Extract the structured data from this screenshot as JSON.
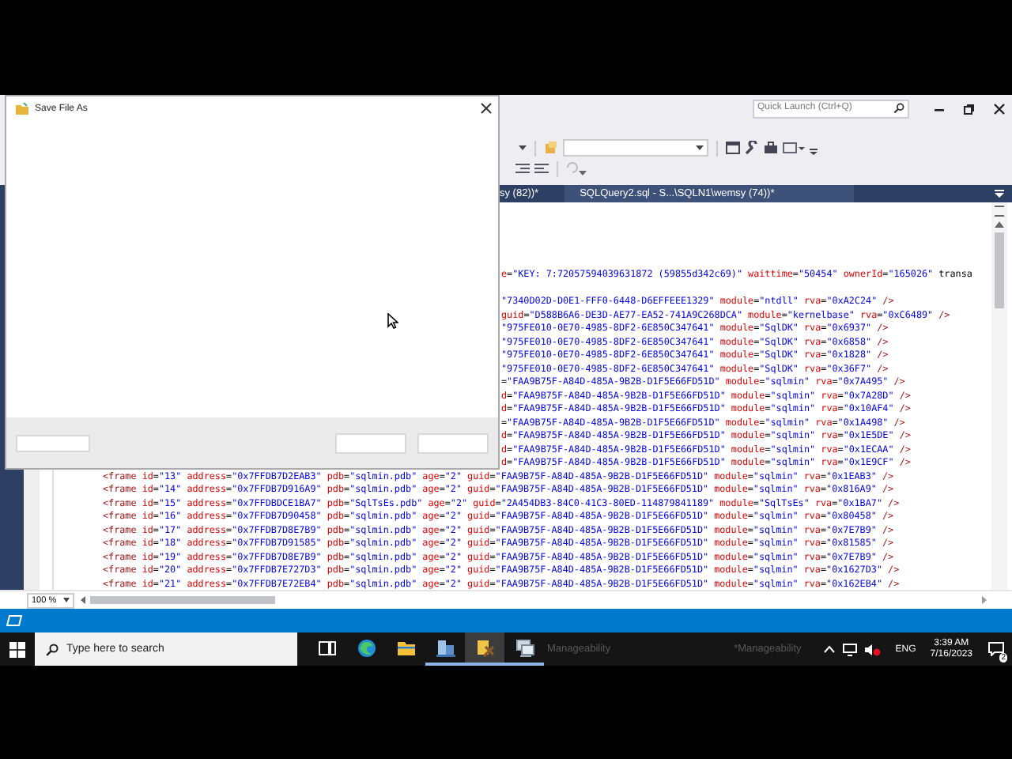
{
  "ssms": {
    "quick_launch": {
      "placeholder": "Quick Launch (Ctrl+Q)"
    },
    "tabs": [
      {
        "label": "sy (82))*",
        "selected": false
      },
      {
        "label": "SQLQuery2.sql - S...\\SQLN1\\wemsy (74))*",
        "selected": false
      }
    ],
    "header_line": "e=\"KEY: 7:72057594039631872 (59855d342c69)\" waittime=\"50454\" ownerId=\"165026\" transa",
    "upper_lines": [
      "\"7340D02D-D0E1-FFF0-6448-D6EFFEEE1329\" module=\"ntdll\" rva=\"0xA2C24\" />",
      "guid=\"D588B6A6-DE3D-AE77-EA52-741A9C268DCA\" module=\"kernelbase\" rva=\"0xC6489\" />",
      "\"975FE010-0E70-4985-8DF2-6E850C347641\" module=\"SqlDK\" rva=\"0x6937\" />",
      "\"975FE010-0E70-4985-8DF2-6E850C347641\" module=\"SqlDK\" rva=\"0x6858\" />",
      "\"975FE010-0E70-4985-8DF2-6E850C347641\" module=\"SqlDK\" rva=\"0x1828\" />",
      "\"975FE010-0E70-4985-8DF2-6E850C347641\" module=\"SqlDK\" rva=\"0x36F7\" />",
      "=\"FAA9B75F-A84D-485A-9B2B-D1F5E66FD51D\" module=\"sqlmin\" rva=\"0x7A495\" />",
      "d=\"FAA9B75F-A84D-485A-9B2B-D1F5E66FD51D\" module=\"sqlmin\" rva=\"0x7A28D\" />",
      "d=\"FAA9B75F-A84D-485A-9B2B-D1F5E66FD51D\" module=\"sqlmin\" rva=\"0x10AF4\" />",
      "=\"FAA9B75F-A84D-485A-9B2B-D1F5E66FD51D\" module=\"sqlmin\" rva=\"0x1A498\" />",
      "d=\"FAA9B75F-A84D-485A-9B2B-D1F5E66FD51D\" module=\"sqlmin\" rva=\"0x1E5DE\" />",
      "d=\"FAA9B75F-A84D-485A-9B2B-D1F5E66FD51D\" module=\"sqlmin\" rva=\"0x1ECAA\" />",
      "d=\"FAA9B75F-A84D-485A-9B2B-D1F5E66FD51D\" module=\"sqlmin\" rva=\"0x1E9CF\" />"
    ],
    "lines": [
      "<frame id=\"13\" address=\"0x7FFDB7D2EAB3\" pdb=\"sqlmin.pdb\" age=\"2\" guid=\"FAA9B75F-A84D-485A-9B2B-D1F5E66FD51D\" module=\"sqlmin\" rva=\"0x1EAB3\" />",
      "<frame id=\"14\" address=\"0x7FFDB7D916A9\" pdb=\"sqlmin.pdb\" age=\"2\" guid=\"FAA9B75F-A84D-485A-9B2B-D1F5E66FD51D\" module=\"sqlmin\" rva=\"0x816A9\" />",
      "<frame id=\"15\" address=\"0x7FFDBDCE1BA7\" pdb=\"SqlTsEs.pdb\" age=\"2\" guid=\"2A454DB3-84C0-41C3-80ED-114879841189\" module=\"SqlTsEs\" rva=\"0x1BA7\" />",
      "<frame id=\"16\" address=\"0x7FFDB7D90458\" pdb=\"sqlmin.pdb\" age=\"2\" guid=\"FAA9B75F-A84D-485A-9B2B-D1F5E66FD51D\" module=\"sqlmin\" rva=\"0x80458\" />",
      "<frame id=\"17\" address=\"0x7FFDB7D8E7B9\" pdb=\"sqlmin.pdb\" age=\"2\" guid=\"FAA9B75F-A84D-485A-9B2B-D1F5E66FD51D\" module=\"sqlmin\" rva=\"0x7E7B9\" />",
      "<frame id=\"18\" address=\"0x7FFDB7D91585\" pdb=\"sqlmin.pdb\" age=\"2\" guid=\"FAA9B75F-A84D-485A-9B2B-D1F5E66FD51D\" module=\"sqlmin\" rva=\"0x81585\" />",
      "<frame id=\"19\" address=\"0x7FFDB7D8E7B9\" pdb=\"sqlmin.pdb\" age=\"2\" guid=\"FAA9B75F-A84D-485A-9B2B-D1F5E66FD51D\" module=\"sqlmin\" rva=\"0x7E7B9\" />",
      "<frame id=\"20\" address=\"0x7FFDB7E727D3\" pdb=\"sqlmin.pdb\" age=\"2\" guid=\"FAA9B75F-A84D-485A-9B2B-D1F5E66FD51D\" module=\"sqlmin\" rva=\"0x1627D3\" />",
      "<frame id=\"21\" address=\"0x7FFDB7E72EB4\" pdb=\"sqlmin.pdb\" age=\"2\" guid=\"FAA9B75F-A84D-485A-9B2B-D1F5E66FD51D\" module=\"sqlmin\" rva=\"0x162EB4\" />"
    ],
    "zoom_level": "100 %"
  },
  "dialog": {
    "title": "Save File As"
  },
  "taskbar": {
    "search_placeholder": "Type here to search",
    "apps": [
      {
        "kind": "task-view",
        "running": false,
        "selected": false
      },
      {
        "kind": "browser",
        "running": false,
        "selected": false
      },
      {
        "kind": "folder",
        "running": false,
        "selected": false
      },
      {
        "kind": "server",
        "running": true,
        "selected": false
      },
      {
        "kind": "tools",
        "running": true,
        "selected": true
      },
      {
        "kind": "computer",
        "running": true,
        "selected": false
      }
    ],
    "ghost_labels": [
      "Manageability",
      "*Manageability"
    ],
    "language": "ENG",
    "time": "3:39 AM",
    "date": "7/16/2023",
    "notifications": "2"
  }
}
